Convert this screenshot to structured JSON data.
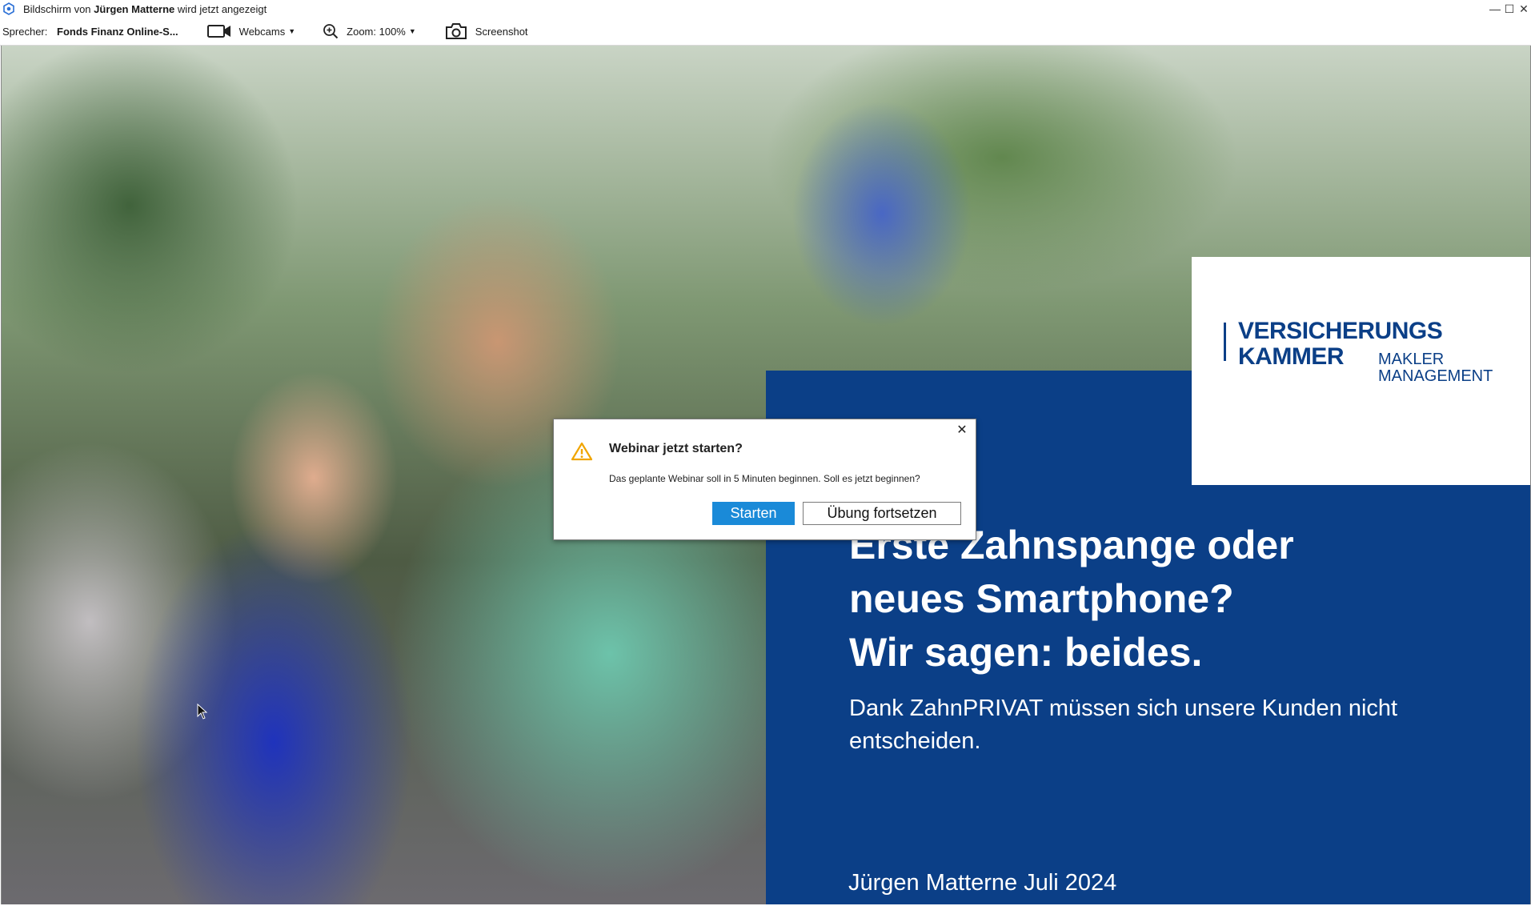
{
  "window": {
    "title_prefix": "Bildschirm von",
    "title_name": "Jürgen Matterne",
    "title_suffix": "wird jetzt angezeigt",
    "controls": {
      "minimize": "—",
      "maximize": "☐",
      "close": "✕"
    }
  },
  "toolbar": {
    "speaker_label": "Sprecher:",
    "speaker_names": "Fonds Finanz Online-S...",
    "webcams_label": "Webcams",
    "zoom_label": "Zoom: 100%",
    "screenshot_label": "Screenshot"
  },
  "slide": {
    "logo_line1": "VERSICHERUNGS",
    "logo_line2": "KAMMER",
    "logo_sub1": "MAKLER",
    "logo_sub2": "MANAGEMENT",
    "headline": [
      "Erste Zahnspange oder",
      "neues Smartphone?",
      "Wir sagen: beides."
    ],
    "subline": "Dank ZahnPRIVAT müssen sich unsere Kunden nicht entscheiden.",
    "author": "Jürgen Matterne Juli 2024",
    "colors": {
      "panel": "#0b3f87"
    }
  },
  "presentation_controls": [
    "prev-icon",
    "next-icon",
    "pen-icon",
    "slides-icon",
    "zoom-icon",
    "more-icon"
  ],
  "dialog": {
    "title": "Webinar jetzt starten?",
    "message": "Das geplante Webinar soll in 5 Minuten beginnen. Soll es jetzt beginnen?",
    "primary_button": "Starten",
    "secondary_button": "Übung fortsetzen",
    "close": "✕",
    "colors": {
      "primary": "#1a8ad8",
      "warning": "#f0a500"
    }
  }
}
